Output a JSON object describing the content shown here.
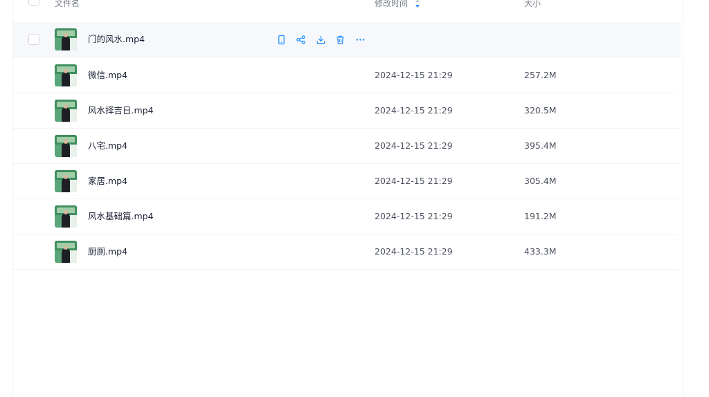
{
  "header": {
    "name_label": "文件名",
    "time_label": "修改时间",
    "size_label": "大小"
  },
  "colors": {
    "accent": "#1e90ff",
    "hover_row": "#f6f8fb"
  },
  "hover_actions": [
    "mobile-icon",
    "share-icon",
    "download-icon",
    "delete-icon",
    "more-icon"
  ],
  "files": [
    {
      "name": "门的风水.mp4",
      "time": "",
      "size": ""
    },
    {
      "name": "微信.mp4",
      "time": "2024-12-15 21:29",
      "size": "257.2M"
    },
    {
      "name": "风水择吉日.mp4",
      "time": "2024-12-15 21:29",
      "size": "320.5M"
    },
    {
      "name": "八宅.mp4",
      "time": "2024-12-15 21:29",
      "size": "395.4M"
    },
    {
      "name": "家居.mp4",
      "time": "2024-12-15 21:29",
      "size": "305.4M"
    },
    {
      "name": "风水基础篇.mp4",
      "time": "2024-12-15 21:29",
      "size": "191.2M"
    },
    {
      "name": "厨厕.mp4",
      "time": "2024-12-15 21:29",
      "size": "433.3M"
    }
  ]
}
